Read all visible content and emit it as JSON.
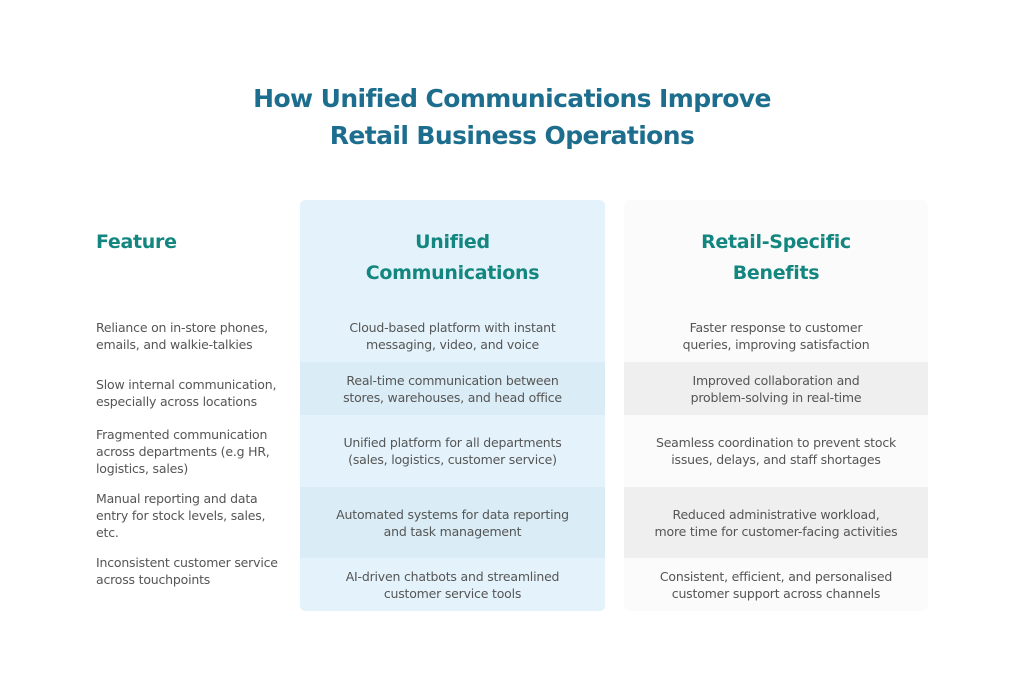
{
  "title": {
    "line1": "How Unified Communications Improve",
    "line2": "Retail Business Operations"
  },
  "colors": {
    "title": "#1d6e8e",
    "header": "#13877f",
    "body_text": "#555555",
    "uc_column_bg": "#e4f3fb",
    "uc_band_bg": "#daecf5",
    "rb_column_bg": "#fbfbfb",
    "rb_band_bg": "#efefef"
  },
  "table": {
    "headers": {
      "feature": "Feature",
      "uc_line1": "Unified",
      "uc_line2": "Communications",
      "rb_line1": "Retail-Specific",
      "rb_line2": "Benefits"
    },
    "rows": [
      {
        "feature": [
          "Reliance on in-store phones,",
          "emails, and walkie-talkies"
        ],
        "uc": [
          "Cloud-based platform with instant",
          "messaging, video, and voice"
        ],
        "rb": [
          "Faster response to customer",
          "queries, improving satisfaction"
        ]
      },
      {
        "feature": [
          "Slow internal communication,",
          "especially across locations"
        ],
        "uc": [
          "Real-time communication between",
          "stores, warehouses, and head office"
        ],
        "rb": [
          "Improved collaboration and",
          "problem-solving in real-time"
        ]
      },
      {
        "feature": [
          "Fragmented communication",
          "across departments (e.g HR,",
          "logistics, sales)"
        ],
        "uc": [
          "Unified platform for all departments",
          "(sales, logistics, customer service)"
        ],
        "rb": [
          "Seamless coordination to prevent stock",
          "issues, delays, and staff shortages"
        ]
      },
      {
        "feature": [
          "Manual reporting and data",
          "entry for stock levels, sales,",
          "etc."
        ],
        "uc": [
          "Automated systems for data reporting",
          "and task management"
        ],
        "rb": [
          "Reduced administrative workload,",
          "more time for customer-facing activities"
        ]
      },
      {
        "feature": [
          "Inconsistent customer service",
          "across touchpoints"
        ],
        "uc": [
          "AI-driven chatbots and streamlined",
          "customer service tools"
        ],
        "rb": [
          "Consistent, efficient, and personalised",
          "customer support across channels"
        ]
      }
    ]
  }
}
